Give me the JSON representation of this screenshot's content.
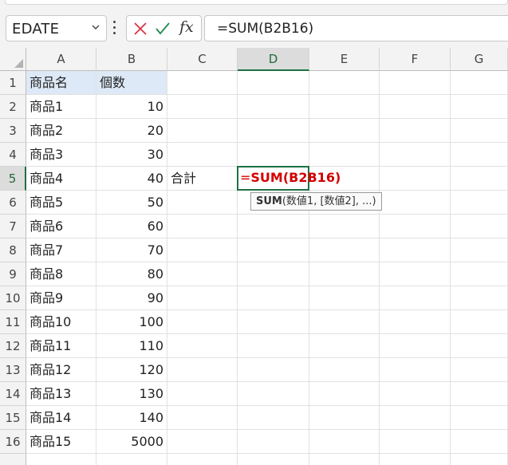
{
  "name_box": {
    "value": "EDATE"
  },
  "formula_bar": {
    "value": "=SUM(B2B16)"
  },
  "columns": [
    "A",
    "B",
    "C",
    "D",
    "E",
    "F",
    "G"
  ],
  "active_column": "D",
  "active_row": "5",
  "rows": [
    {
      "num": "1",
      "a": "商品名",
      "b": "個数",
      "c": ""
    },
    {
      "num": "2",
      "a": "商品1",
      "b": "10",
      "c": ""
    },
    {
      "num": "3",
      "a": "商品2",
      "b": "20",
      "c": ""
    },
    {
      "num": "4",
      "a": "商品3",
      "b": "30",
      "c": ""
    },
    {
      "num": "5",
      "a": "商品4",
      "b": "40",
      "c": "合計"
    },
    {
      "num": "6",
      "a": "商品5",
      "b": "50",
      "c": ""
    },
    {
      "num": "7",
      "a": "商品6",
      "b": "60",
      "c": ""
    },
    {
      "num": "8",
      "a": "商品7",
      "b": "70",
      "c": ""
    },
    {
      "num": "9",
      "a": "商品8",
      "b": "80",
      "c": ""
    },
    {
      "num": "10",
      "a": "商品9",
      "b": "90",
      "c": ""
    },
    {
      "num": "11",
      "a": "商品10",
      "b": "100",
      "c": ""
    },
    {
      "num": "12",
      "a": "商品11",
      "b": "110",
      "c": ""
    },
    {
      "num": "13",
      "a": "商品12",
      "b": "120",
      "c": ""
    },
    {
      "num": "14",
      "a": "商品13",
      "b": "130",
      "c": ""
    },
    {
      "num": "15",
      "a": "商品14",
      "b": "140",
      "c": ""
    },
    {
      "num": "16",
      "a": "商品15",
      "b": "5000",
      "c": ""
    }
  ],
  "active_cell": {
    "eq": "=",
    "formula": "SUM(B2B16)"
  },
  "tooltip": {
    "fn": "SUM",
    "args": "(数値1, [数値2], ...)"
  },
  "icons": {
    "cancel": "close-icon",
    "enter": "check-icon",
    "fx": "fx-icon",
    "menu": "kebab-icon",
    "dropdown": "chevron-down-icon"
  },
  "colors": {
    "accent": "#1e7145",
    "cancel": "#d9333f",
    "enter": "#1e8a4c",
    "formula_text": "#d40000",
    "header_highlight": "#dde9f6"
  }
}
